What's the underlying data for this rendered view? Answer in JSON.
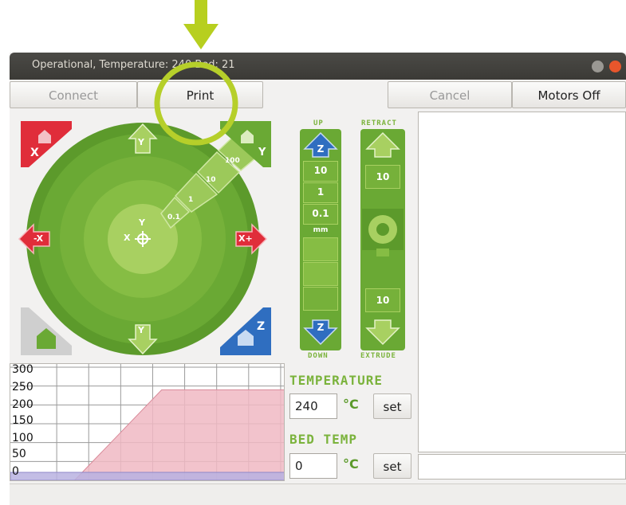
{
  "window": {
    "title": "Operational, Temperature: 240 Bed: 21"
  },
  "toolbar": {
    "connect_label": "Connect",
    "print_label": "Print",
    "cancel_label": "Cancel",
    "motors_off_label": "Motors Off"
  },
  "jog_xy": {
    "home_x": "X",
    "home_y": "Y",
    "home_z": "Z",
    "minus_x": "-X",
    "plus_x": "X+",
    "plus_y": "Y",
    "minus_y": "Y",
    "center_x": "X",
    "center_y": "Y",
    "steps": [
      "0.1",
      "1",
      "10",
      "100"
    ]
  },
  "jog_z": {
    "up_label": "UP",
    "down_label": "DOWN",
    "steps": [
      "10",
      "1",
      "0.1"
    ],
    "unit": "mm",
    "up_arrow_letter": "Z",
    "down_arrow_letter": "Z"
  },
  "extruder": {
    "retract_label": "RETRACT",
    "extrude_label": "EXTRUDE",
    "retract_amount": "10",
    "extrude_amount": "10"
  },
  "temperature": {
    "label": "TEMPERATURE",
    "value": "240",
    "unit": "°C",
    "set_label": "set"
  },
  "bed_temp": {
    "label": "BED TEMP",
    "value": "0",
    "unit": "°C",
    "set_label": "set"
  },
  "chart_data": {
    "type": "area",
    "ylim": [
      0,
      300
    ],
    "yticks": [
      "300",
      "250",
      "200",
      "150",
      "100",
      "50",
      "0"
    ],
    "xlim": [
      0,
      300
    ],
    "series": [
      {
        "color": "#f0b9c3",
        "x": [
          0,
          70,
          165,
          300
        ],
        "values": [
          0,
          0,
          240,
          240
        ]
      },
      {
        "color": "#b8b2e0",
        "x": [
          0,
          300
        ],
        "values": [
          21,
          21
        ]
      }
    ]
  },
  "colors": {
    "green_dark": "#5c9a2b",
    "green_mid": "#76b13a",
    "green_light": "#a8d061",
    "accent_ring": "#b6cf2a",
    "red": "#e02d3a",
    "blue": "#2f6ec0"
  }
}
